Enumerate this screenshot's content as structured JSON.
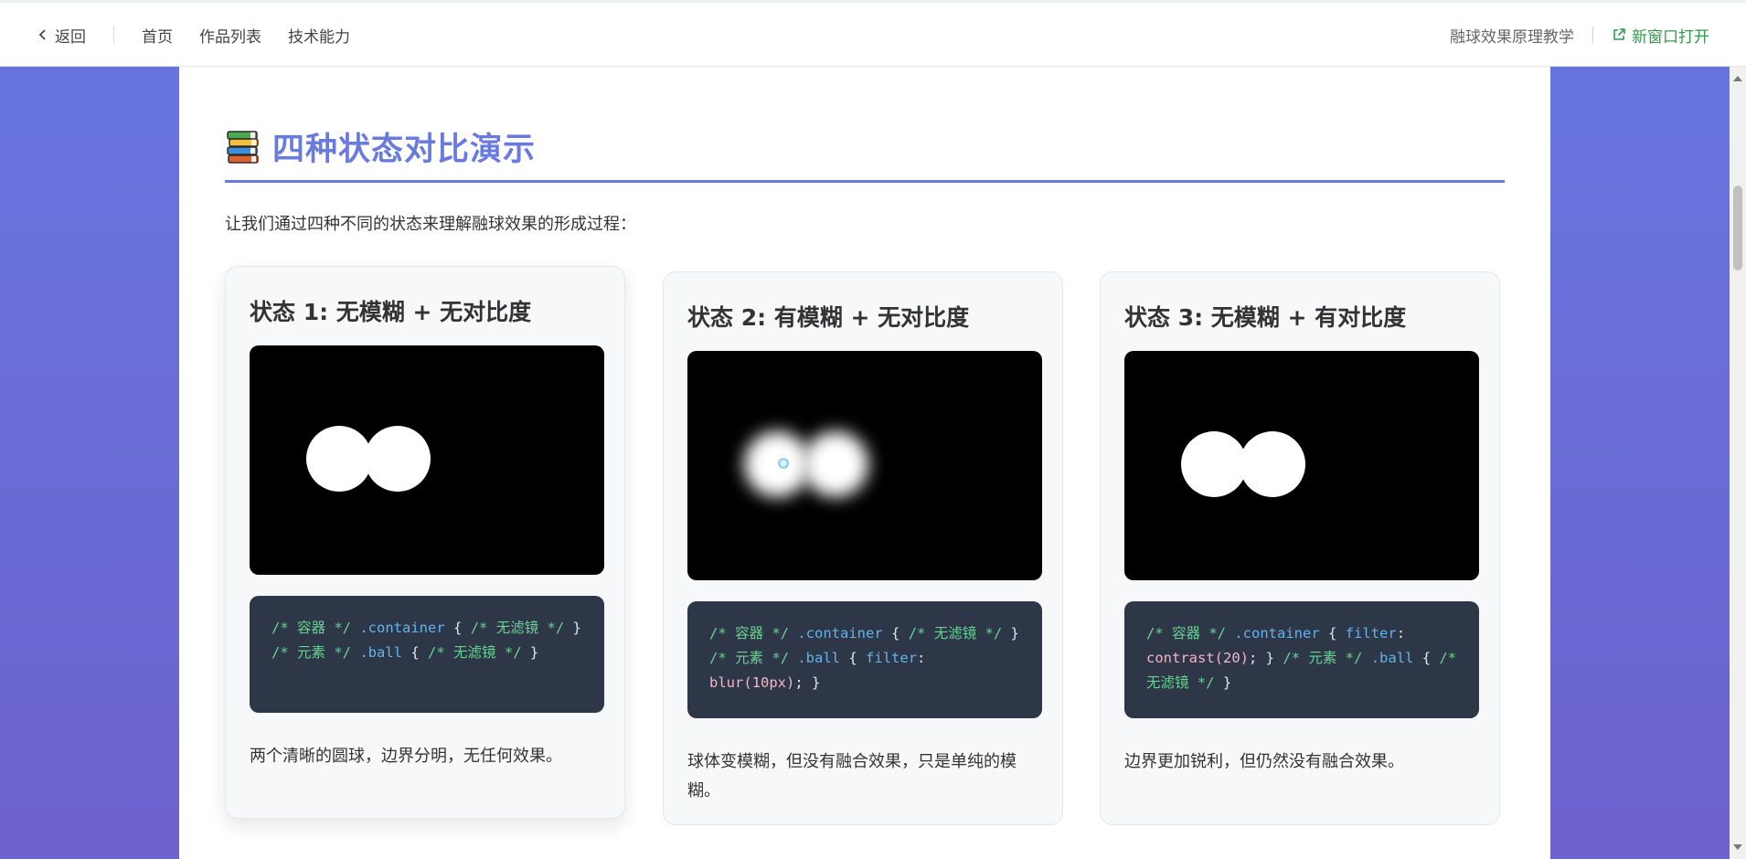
{
  "topbar": {
    "back_label": "返回",
    "nav": [
      "首页",
      "作品列表",
      "技术能力"
    ],
    "page_title": "融球效果原理教学",
    "new_window_label": "新窗口打开",
    "accent_color": "#2f9a4c"
  },
  "section": {
    "title": "四种状态对比演示",
    "icon": "books-icon",
    "intro": "让我们通过四种不同的状态来理解融球效果的形成过程：",
    "accent_color": "#6a7bdf"
  },
  "cards": [
    {
      "title": "状态 1: 无模糊 + 无对比度",
      "code": {
        "comment_container": "/* 容器 */",
        "sel_container": ".container",
        "body_container_comment": "/* 无滤镜 */",
        "comment_ball": "/* 元素 */",
        "sel_ball": ".ball",
        "body_ball_comment": "/* 无滤镜 */"
      },
      "desc": "两个清晰的圆球，边界分明，无任何效果。"
    },
    {
      "title": "状态 2: 有模糊 + 无对比度",
      "code": {
        "comment_container": "/* 容器 */",
        "sel_container": ".container",
        "body_container_comment": "/* 无滤镜 */",
        "comment_ball": "/* 元素 */",
        "sel_ball": ".ball",
        "prop": "filter",
        "val": "blur(10px)"
      },
      "desc": "球体变模糊，但没有融合效果，只是单纯的模糊。"
    },
    {
      "title": "状态 3: 无模糊 + 有对比度",
      "code": {
        "comment_container": "/* 容器 */",
        "sel_container": ".container",
        "prop": "filter",
        "val": "contrast(20)",
        "comment_ball": "/* 元素 */",
        "sel_ball": ".ball",
        "body_ball_comment": "/* 无滤镜 */"
      },
      "desc": "边界更加锐利，但仍然没有融合效果。"
    }
  ]
}
